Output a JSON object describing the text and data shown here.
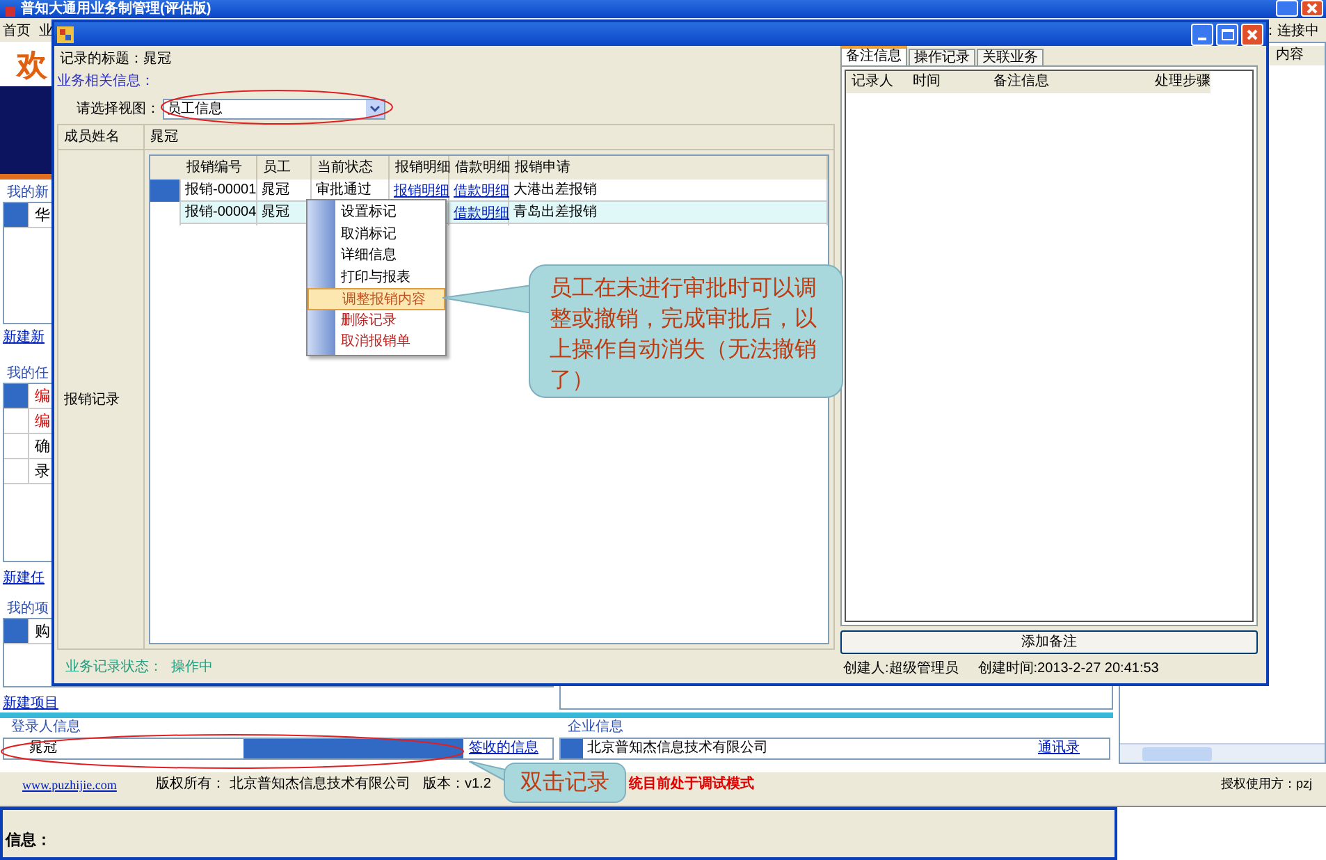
{
  "main_window": {
    "title": "普知大通用业务制管理(评估版)",
    "menu": [
      "首页",
      "业"
    ],
    "welcome": "欢",
    "status": "：连接中",
    "news": {
      "heading": "我的新",
      "items": [
        {
          "text": "华",
          "selected": true
        }
      ],
      "link": "新建新"
    },
    "tasks": {
      "heading": "我的任",
      "items": [
        {
          "text": "编",
          "kind": "urgent",
          "selected": true
        },
        {
          "text": "编",
          "kind": "urgent",
          "selected": false
        },
        {
          "text": "确",
          "kind": "normal",
          "selected": false
        },
        {
          "text": "录",
          "kind": "normal",
          "selected": false
        }
      ],
      "link": "新建任"
    },
    "projects": {
      "heading": "我的项",
      "items": [
        {
          "text": "购",
          "selected": true
        }
      ],
      "link": "新建项目"
    },
    "right_list": {
      "column": "内容"
    },
    "login_info": {
      "heading": "登录人信息",
      "name": "晁冠",
      "link": "签收的信息"
    },
    "company_info": {
      "heading": "企业信息",
      "name": "北京普知杰信息技术有限公司",
      "link": "通讯录"
    },
    "footer": {
      "website": "www.puzhijie.com",
      "copyright": "版权所有： 北京普知杰信息技术有限公司",
      "version": "版本：v1.2",
      "notice": "统目前处于调试模式",
      "license": "授权使用方：pzj"
    },
    "info_panel": {
      "label": "信息："
    }
  },
  "dialog": {
    "record_title_label": "记录的标题：",
    "record_title": "晁冠",
    "section": "业务相关信息：",
    "view_label": "请选择视图：",
    "view_value": "员工信息",
    "member_label": "成员姓名",
    "member_name": "晁冠",
    "records_label": "报销记录",
    "table": {
      "columns": [
        "报销编号",
        "员工",
        "当前状态",
        "报销明细",
        "借款明细",
        "报销申请"
      ],
      "rows": [
        {
          "selected": true,
          "hovered": false,
          "cells": [
            {
              "kind": "text",
              "text": "报销-00001"
            },
            {
              "kind": "text",
              "text": "晁冠"
            },
            {
              "kind": "text",
              "text": "审批通过"
            },
            {
              "kind": "link",
              "text": "报销明细"
            },
            {
              "kind": "link",
              "text": "借款明细"
            },
            {
              "kind": "text",
              "text": "大港出差报销"
            }
          ]
        },
        {
          "selected": false,
          "hovered": true,
          "cells": [
            {
              "kind": "text",
              "text": "报销-00004"
            },
            {
              "kind": "text",
              "text": "晁冠"
            },
            {
              "kind": "covered"
            },
            {
              "kind": "covered"
            },
            {
              "kind": "link",
              "text": "借款明细"
            },
            {
              "kind": "text",
              "text": "青岛出差报销"
            }
          ]
        }
      ]
    },
    "status_label": "业务记录状态：",
    "status": "操作中",
    "side": {
      "tabs": [
        {
          "label": "备注信息",
          "selected": true
        },
        {
          "label": "操作记录",
          "selected": false
        },
        {
          "label": "关联业务",
          "selected": false
        }
      ],
      "columns": [
        "记录人",
        "时间",
        "备注信息",
        "处理步骤"
      ],
      "button": "添加备注",
      "creator": "创建人:超级管理员",
      "created": "创建时间:2013-2-27 20:41:53"
    }
  },
  "context_menu": {
    "items": [
      {
        "label": "设置标记",
        "kind": "normal",
        "selected": false
      },
      {
        "label": "取消标记",
        "kind": "normal",
        "selected": false
      },
      {
        "label": "详细信息",
        "kind": "normal",
        "selected": false
      },
      {
        "label": "打印与报表",
        "kind": "normal",
        "selected": false
      },
      {
        "label": "调整报销内容",
        "kind": "normal",
        "selected": true
      },
      {
        "label": "删除记录",
        "kind": "danger",
        "selected": false
      },
      {
        "label": "取消报销单",
        "kind": "danger",
        "selected": false
      }
    ]
  },
  "callouts": [
    {
      "text": "员工在未进行审批时可以调整或撤销，完成审批后，以上操作自动消失（无法撤销了）"
    },
    {
      "text": "双击记录"
    }
  ]
}
